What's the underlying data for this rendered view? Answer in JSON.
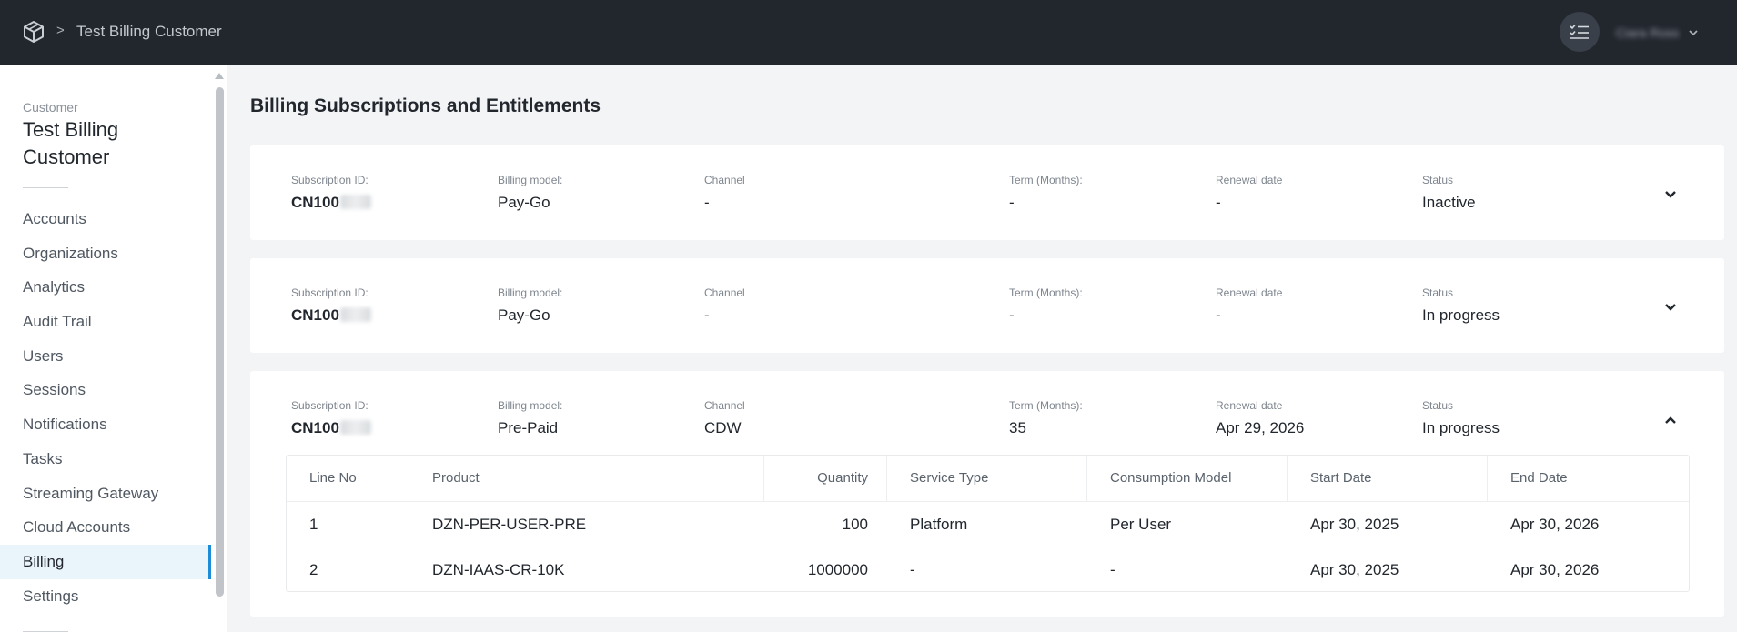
{
  "header": {
    "breadcrumb_separator": ">",
    "title": "Test Billing Customer",
    "user_name": "Ciara Ross"
  },
  "sidebar": {
    "eyebrow": "Customer",
    "customer_name": "Test Billing Customer",
    "items": [
      {
        "label": "Accounts"
      },
      {
        "label": "Organizations"
      },
      {
        "label": "Analytics"
      },
      {
        "label": "Audit Trail"
      },
      {
        "label": "Users"
      },
      {
        "label": "Sessions"
      },
      {
        "label": "Notifications"
      },
      {
        "label": "Tasks"
      },
      {
        "label": "Streaming Gateway"
      },
      {
        "label": "Cloud Accounts"
      },
      {
        "label": "Billing"
      },
      {
        "label": "Settings"
      }
    ],
    "active_item": "Billing"
  },
  "main": {
    "title": "Billing Subscriptions and Entitlements",
    "labels": {
      "subscription_id": "Subscription ID:",
      "billing_model": "Billing model:",
      "channel": "Channel",
      "term": "Term (Months):",
      "renewal": "Renewal date",
      "status": "Status"
    },
    "subscriptions": [
      {
        "id_prefix": "CN100",
        "billing_model": "Pay-Go",
        "channel": "-",
        "term": "-",
        "renewal": "-",
        "status": "Inactive",
        "expanded": false
      },
      {
        "id_prefix": "CN100",
        "billing_model": "Pay-Go",
        "channel": "-",
        "term": "-",
        "renewal": "-",
        "status": "In progress",
        "expanded": false
      },
      {
        "id_prefix": "CN100",
        "billing_model": "Pre-Paid",
        "channel": "CDW",
        "term": "35",
        "renewal": "Apr 29, 2026",
        "status": "In progress",
        "expanded": true
      }
    ],
    "line_items": {
      "columns": [
        "Line No",
        "Product",
        "Quantity",
        "Service Type",
        "Consumption Model",
        "Start Date",
        "End Date"
      ],
      "rows": [
        [
          "1",
          "DZN-PER-USER-PRE",
          "100",
          "Platform",
          "Per User",
          "Apr 30, 2025",
          "Apr 30, 2026"
        ],
        [
          "2",
          "DZN-IAAS-CR-10K",
          "1000000",
          "-",
          "-",
          "Apr 30, 2025",
          "Apr 30, 2026"
        ]
      ]
    }
  },
  "icons": {
    "logo": "cube-logo-icon",
    "tasks": "checklist-icon",
    "user_menu": "chevron-down-icon",
    "expand": "chevron-down-icon",
    "collapse": "chevron-up-icon"
  },
  "colors": {
    "topbar": "#22272e",
    "accent": "#1a8cd8",
    "active_nav_bg": "#eaf4fb",
    "page_bg": "#f3f4f5"
  }
}
